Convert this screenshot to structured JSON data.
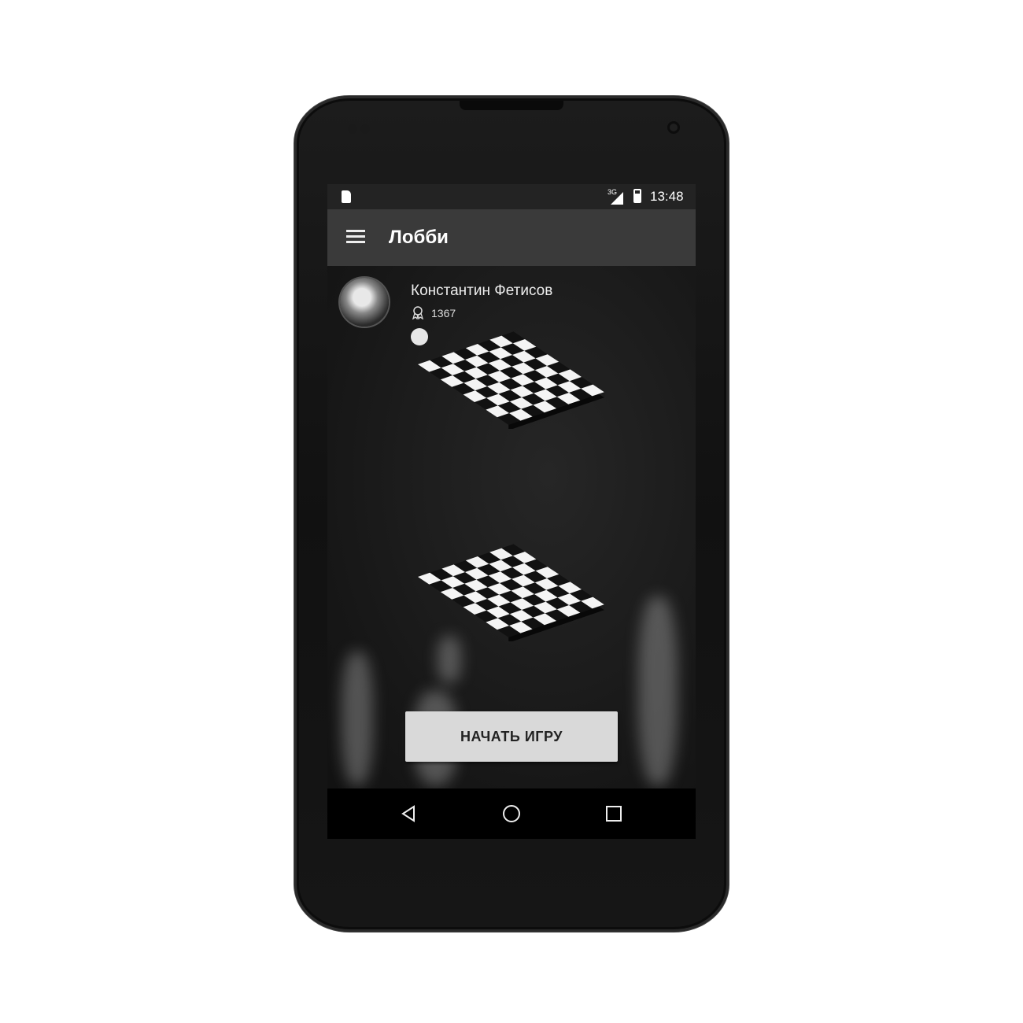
{
  "statusbar": {
    "network": "3G",
    "time": "13:48"
  },
  "appbar": {
    "title": "Лобби"
  },
  "player": {
    "name": "Константин Фетисов",
    "rating": "1367",
    "piece_color": "white"
  },
  "start_button": {
    "label": "НАЧАТЬ ИГРУ"
  },
  "navbar": {
    "back_icon": "back-triangle-icon",
    "home_icon": "home-circle-icon",
    "recents_icon": "recents-square-icon"
  },
  "colors": {
    "appbar": "#3a3a3a",
    "statusbar": "#232323",
    "button": "#d9d9d9",
    "background": "#1b1b1b"
  }
}
